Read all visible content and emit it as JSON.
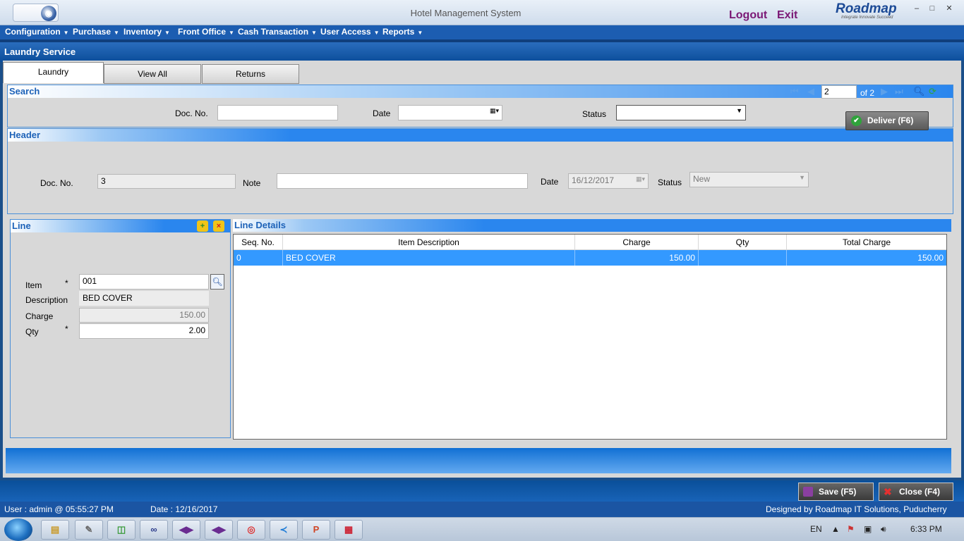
{
  "window": {
    "title": "Hotel Management System",
    "logout": "Logout",
    "exit": "Exit",
    "brand_name": "Roadmap",
    "brand_tagline": "Integrate Innovate Succeed"
  },
  "menu": [
    {
      "label": "Configuration"
    },
    {
      "label": "Purchase"
    },
    {
      "label": "Inventory"
    },
    {
      "label": "Front Office"
    },
    {
      "label": "Cash Transaction"
    },
    {
      "label": "User Access"
    },
    {
      "label": "Reports"
    }
  ],
  "form_title": "Laundry Service",
  "tabs": [
    {
      "label": "Laundry",
      "active": true
    },
    {
      "label": "View All",
      "active": false
    },
    {
      "label": "Returns",
      "active": false
    }
  ],
  "search": {
    "title": "Search",
    "pager_current": "2",
    "pager_of": "of 2",
    "doc_no_label": "Doc. No.",
    "doc_no_value": "",
    "date_label": "Date",
    "date_value": "",
    "status_label": "Status",
    "status_value": ""
  },
  "header": {
    "title": "Header",
    "doc_no_label": "Doc. No.",
    "doc_no_value": "3",
    "note_label": "Note",
    "note_value": "",
    "date_label": "Date",
    "date_value": "16/12/2017",
    "status_label": "Status",
    "status_value": "New",
    "deliver_label": "Deliver (F6)"
  },
  "line": {
    "title": "Line",
    "item_label": "Item",
    "item_required": "*",
    "item_value": "001",
    "description_label": "Description",
    "description_value": "BED COVER",
    "charge_label": "Charge",
    "charge_value": "150.00",
    "qty_label": "Qty",
    "qty_required": "*",
    "qty_value": "2.00"
  },
  "line_details": {
    "title": "Line Details",
    "columns": [
      "Seq. No.",
      "Item Description",
      "Charge",
      "Qty",
      "Total Charge"
    ],
    "rows": [
      {
        "seq": "0",
        "description": "BED COVER",
        "charge": "150.00",
        "qty": "",
        "total": "150.00"
      }
    ]
  },
  "footer": {
    "save_label": "Save (F5)",
    "close_label": "Close (F4)"
  },
  "status": {
    "user": "User : admin  @ 05:55:27 PM",
    "date": "Date : 12/16/2017",
    "designed_by": "Designed by Roadmap IT Solutions, Puducherry"
  },
  "taskbar": {
    "lang": "EN",
    "clock": "6:33 PM"
  },
  "colors": {
    "menu_bg": "#1c5db1",
    "panel_accent": "#2a86ee",
    "row_selected": "#3399ff",
    "logout_color": "#7a1775"
  }
}
